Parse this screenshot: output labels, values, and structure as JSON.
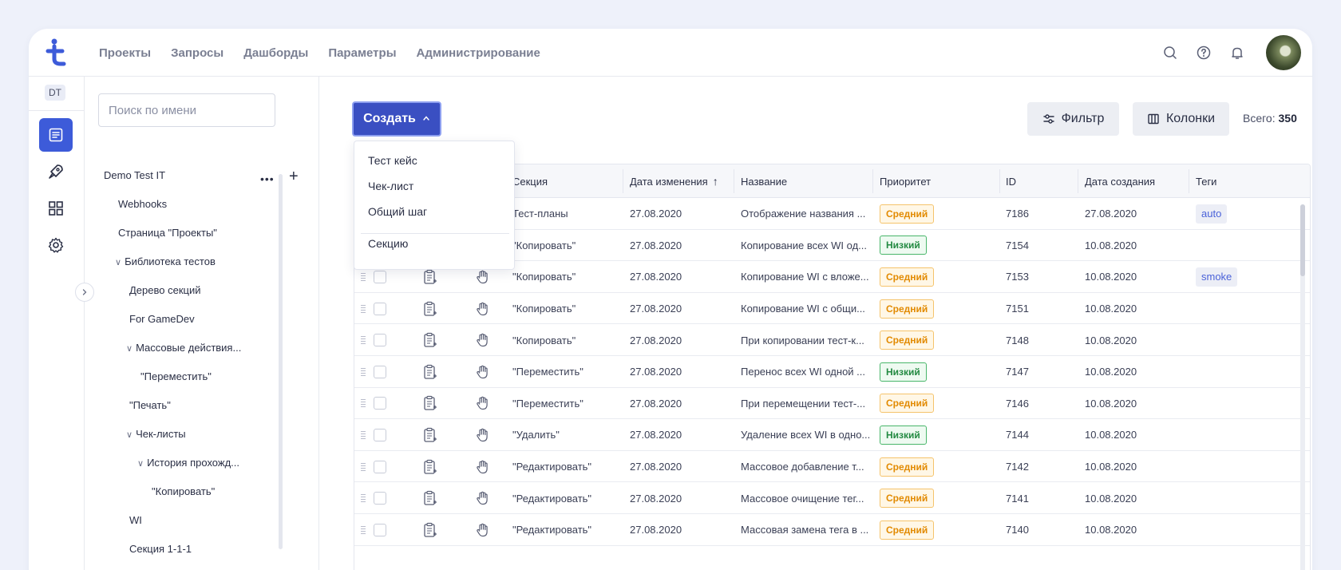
{
  "nav": {
    "items": [
      "Проекты",
      "Запросы",
      "Дашборды",
      "Параметры",
      "Администрирование"
    ]
  },
  "header_icons": [
    "search-icon",
    "help-icon",
    "bell-icon",
    "avatar"
  ],
  "rail": {
    "project_badge": "DT",
    "icons": [
      "test-library-icon",
      "rocket-icon",
      "dashboard-icon",
      "settings-icon"
    ]
  },
  "tree": {
    "search_placeholder": "Поиск по имени",
    "project": "Demo Test IT",
    "items": [
      "Webhooks",
      "Страница \"Проекты\"",
      "Библиотека тестов",
      "Дерево секций",
      "For GameDev",
      "Массовые действия...",
      "\"Переместить\"",
      "\"Печать\"",
      "Чек-листы",
      "История прохожд...",
      "\"Копировать\"",
      "WI",
      "Секция 1-1-1"
    ]
  },
  "toolbar": {
    "create_label": "Создать",
    "filter_label": "Фильтр",
    "columns_label": "Колонки",
    "total_label": "Всего:",
    "total_value": "350"
  },
  "create_menu": {
    "items": [
      "Тест кейс",
      "Чек-лист",
      "Общий шаг",
      "Секцию"
    ]
  },
  "table": {
    "columns": [
      "Секция",
      "Дата изменения",
      "Название",
      "Приоритет",
      "ID",
      "Дата создания",
      "Теги"
    ],
    "sort_indicator": "↑",
    "rows": [
      {
        "section": "Тест-планы",
        "modified": "27.08.2020",
        "name": "Отображение названия ...",
        "priority": "Средний",
        "id": "7186",
        "created": "27.08.2020",
        "tag": "auto"
      },
      {
        "section": "\"Копировать\"",
        "modified": "27.08.2020",
        "name": "Копирование всех WI од...",
        "priority": "Низкий",
        "id": "7154",
        "created": "10.08.2020",
        "tag": ""
      },
      {
        "section": "\"Копировать\"",
        "modified": "27.08.2020",
        "name": "Копирование WI с вложе...",
        "priority": "Средний",
        "id": "7153",
        "created": "10.08.2020",
        "tag": "smoke"
      },
      {
        "section": "\"Копировать\"",
        "modified": "27.08.2020",
        "name": "Копирование WI с общи...",
        "priority": "Средний",
        "id": "7151",
        "created": "10.08.2020",
        "tag": ""
      },
      {
        "section": "\"Копировать\"",
        "modified": "27.08.2020",
        "name": "При копировании тест-к...",
        "priority": "Средний",
        "id": "7148",
        "created": "10.08.2020",
        "tag": ""
      },
      {
        "section": "\"Переместить\"",
        "modified": "27.08.2020",
        "name": "Перенос всех WI одной ...",
        "priority": "Низкий",
        "id": "7147",
        "created": "10.08.2020",
        "tag": ""
      },
      {
        "section": "\"Переместить\"",
        "modified": "27.08.2020",
        "name": "При перемещении тест-...",
        "priority": "Средний",
        "id": "7146",
        "created": "10.08.2020",
        "tag": ""
      },
      {
        "section": "\"Удалить\"",
        "modified": "27.08.2020",
        "name": "Удаление всех WI в одно...",
        "priority": "Низкий",
        "id": "7144",
        "created": "10.08.2020",
        "tag": ""
      },
      {
        "section": "\"Редактировать\"",
        "modified": "27.08.2020",
        "name": "Массовое добавление т...",
        "priority": "Средний",
        "id": "7142",
        "created": "10.08.2020",
        "tag": ""
      },
      {
        "section": "\"Редактировать\"",
        "modified": "27.08.2020",
        "name": "Массовое очищение тег...",
        "priority": "Средний",
        "id": "7141",
        "created": "10.08.2020",
        "tag": ""
      },
      {
        "section": "\"Редактировать\"",
        "modified": "27.08.2020",
        "name": "Массовая замена тега в ...",
        "priority": "Средний",
        "id": "7140",
        "created": "10.08.2020",
        "tag": ""
      }
    ],
    "priority_colors": {
      "Средний": "#e28a00",
      "Низкий": "#238a42"
    }
  },
  "colors": {
    "accent": "#3d5bd9",
    "create_button": "#3a4fc2",
    "tag_text": "#4a62d9"
  }
}
